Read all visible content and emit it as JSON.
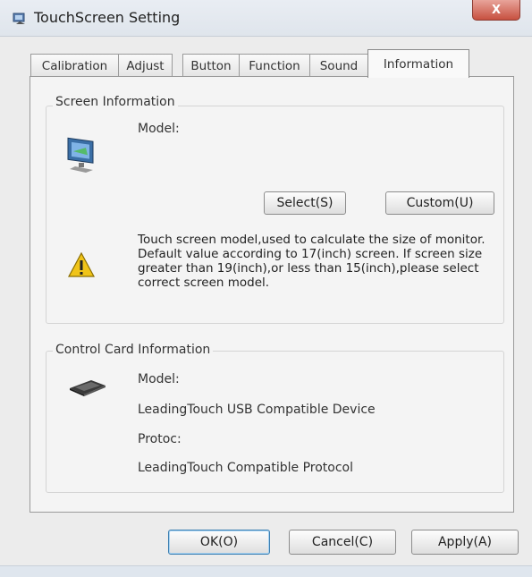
{
  "window": {
    "title": "TouchScreen Setting",
    "close_symbol": "X"
  },
  "tabs": [
    {
      "label": "Calibration"
    },
    {
      "label": "Adjust"
    },
    {
      "label": "Button"
    },
    {
      "label": "Function"
    },
    {
      "label": "Sound"
    },
    {
      "label": "Information",
      "active": true
    }
  ],
  "screen_info": {
    "group_title": "Screen Information",
    "model_label": "Model:",
    "select_button": "Select(S)",
    "custom_button": "Custom(U)",
    "description": "Touch screen model,used to calculate the size of monitor. Default value according to 17(inch) screen. If screen size greater than 19(inch),or less than 15(inch),please select correct screen model."
  },
  "control_card": {
    "group_title": "Control Card Information",
    "model_label": "Model:",
    "model_value": "LeadingTouch USB Compatible Device",
    "protocol_label": "Protoc:",
    "protocol_value": "LeadingTouch Compatible Protocol"
  },
  "footer": {
    "ok_button": "OK(O)",
    "cancel_button": "Cancel(C)",
    "apply_button": "Apply(A)"
  },
  "icons": [
    "app-icon",
    "close-icon",
    "monitor-icon",
    "warning-icon",
    "usb-device-icon"
  ],
  "colors": {
    "title_bar": "#dfe5ec",
    "close_button": "#c75040",
    "warning": "#f0c419"
  }
}
